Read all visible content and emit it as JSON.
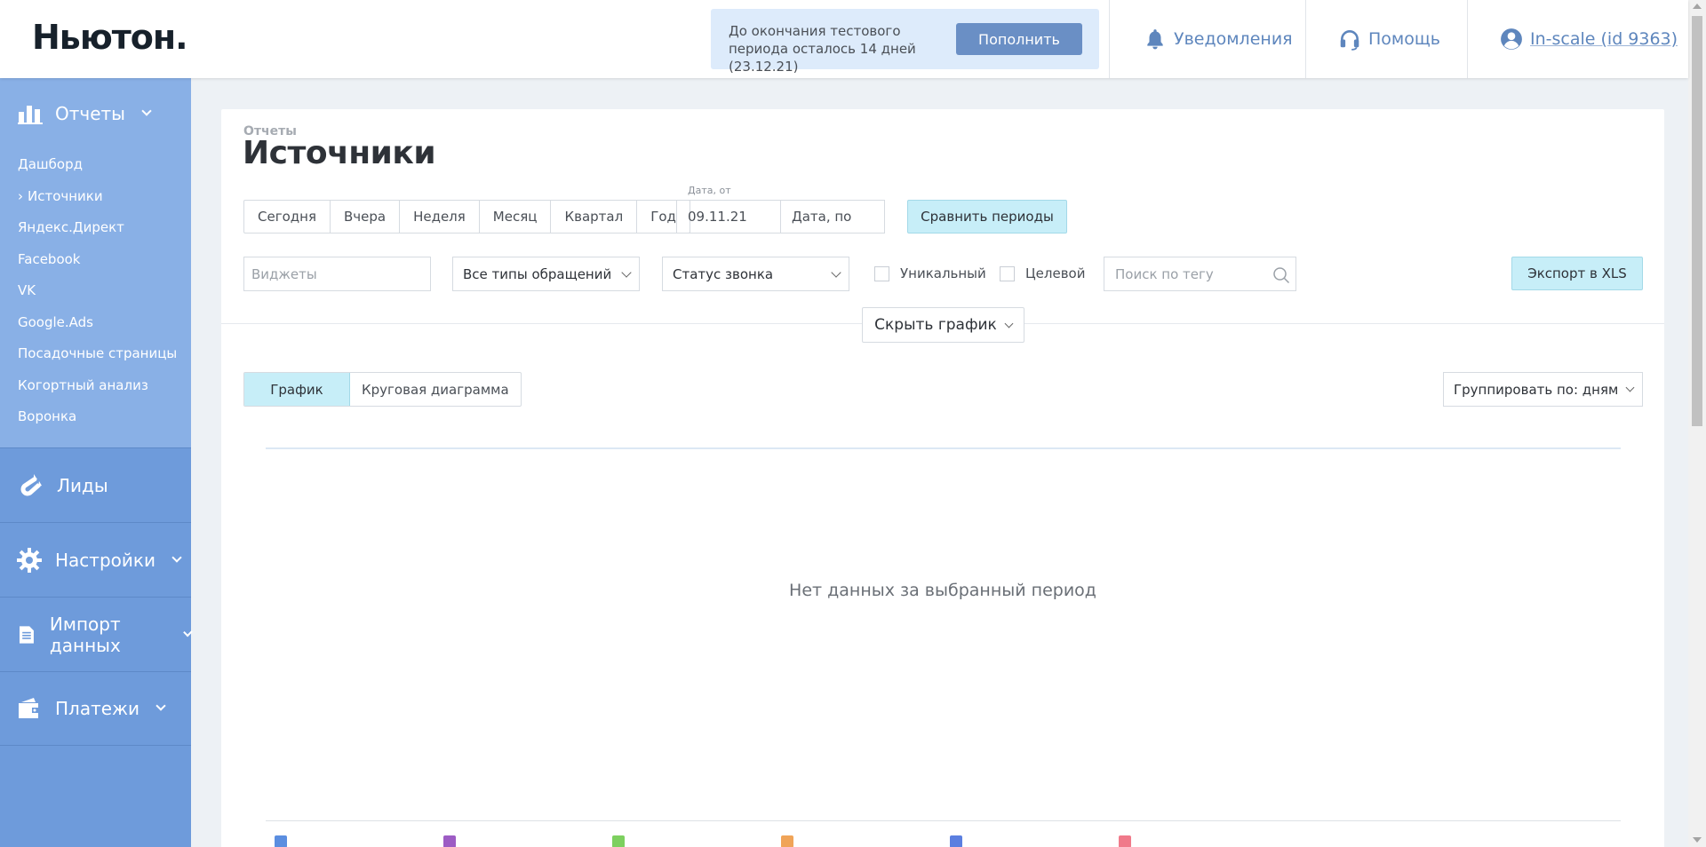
{
  "header": {
    "logo": "Ньютон.",
    "trial_text": "До окончания тестового периода осталось 14 дней (23.12.21)",
    "topup_label": "Пополнить",
    "notifications_label": "Уведомления",
    "help_label": "Помощь",
    "account_label": "In-scale (id 9363)"
  },
  "sidebar": {
    "reports_label": "Отчеты",
    "report_items": [
      "Дашборд",
      "Источники",
      "Яндекс.Директ",
      "Facebook",
      "VK",
      "Google.Ads",
      "Посадочные страницы",
      "Когортный анализ",
      "Воронка"
    ],
    "active_report": "Источники",
    "sections": [
      "Лиды",
      "Настройки",
      "Импорт данных",
      "Платежи"
    ]
  },
  "page": {
    "breadcrumb": "Отчеты",
    "title": "Источники",
    "periods": [
      "Сегодня",
      "Вчера",
      "Неделя",
      "Месяц",
      "Квартал",
      "Год"
    ],
    "date_from_label": "Дата, от",
    "date_from_value": "09.11.21",
    "date_to_placeholder": "Дата, по",
    "compare_label": "Сравнить периоды",
    "widgets_placeholder": "Виджеты",
    "types_select": "Все типы обращений",
    "status_select": "Статус звонка",
    "unique_label": "Уникальный",
    "target_label": "Целевой",
    "tag_search_placeholder": "Поиск по тегу",
    "export_label": "Экспорт в XLS",
    "hide_chart_label": "Скрыть график",
    "view_tabs": [
      "График",
      "Круговая диаграмма"
    ],
    "active_view": "График",
    "group_by": "Группировать по: дням",
    "no_data": "Нет данных за выбранный период"
  },
  "legend_colors": [
    "#5b8ee0",
    "#9d5cc4",
    "#7dd05f",
    "#f0a458",
    "#5b7fe0",
    "#f07a8a"
  ],
  "colors": {
    "sidebar": "#6e9bdb",
    "sidebar_reports": "#89b0e6",
    "accent_button": "#6a8fc5",
    "highlight_button": "#c7eef8"
  }
}
